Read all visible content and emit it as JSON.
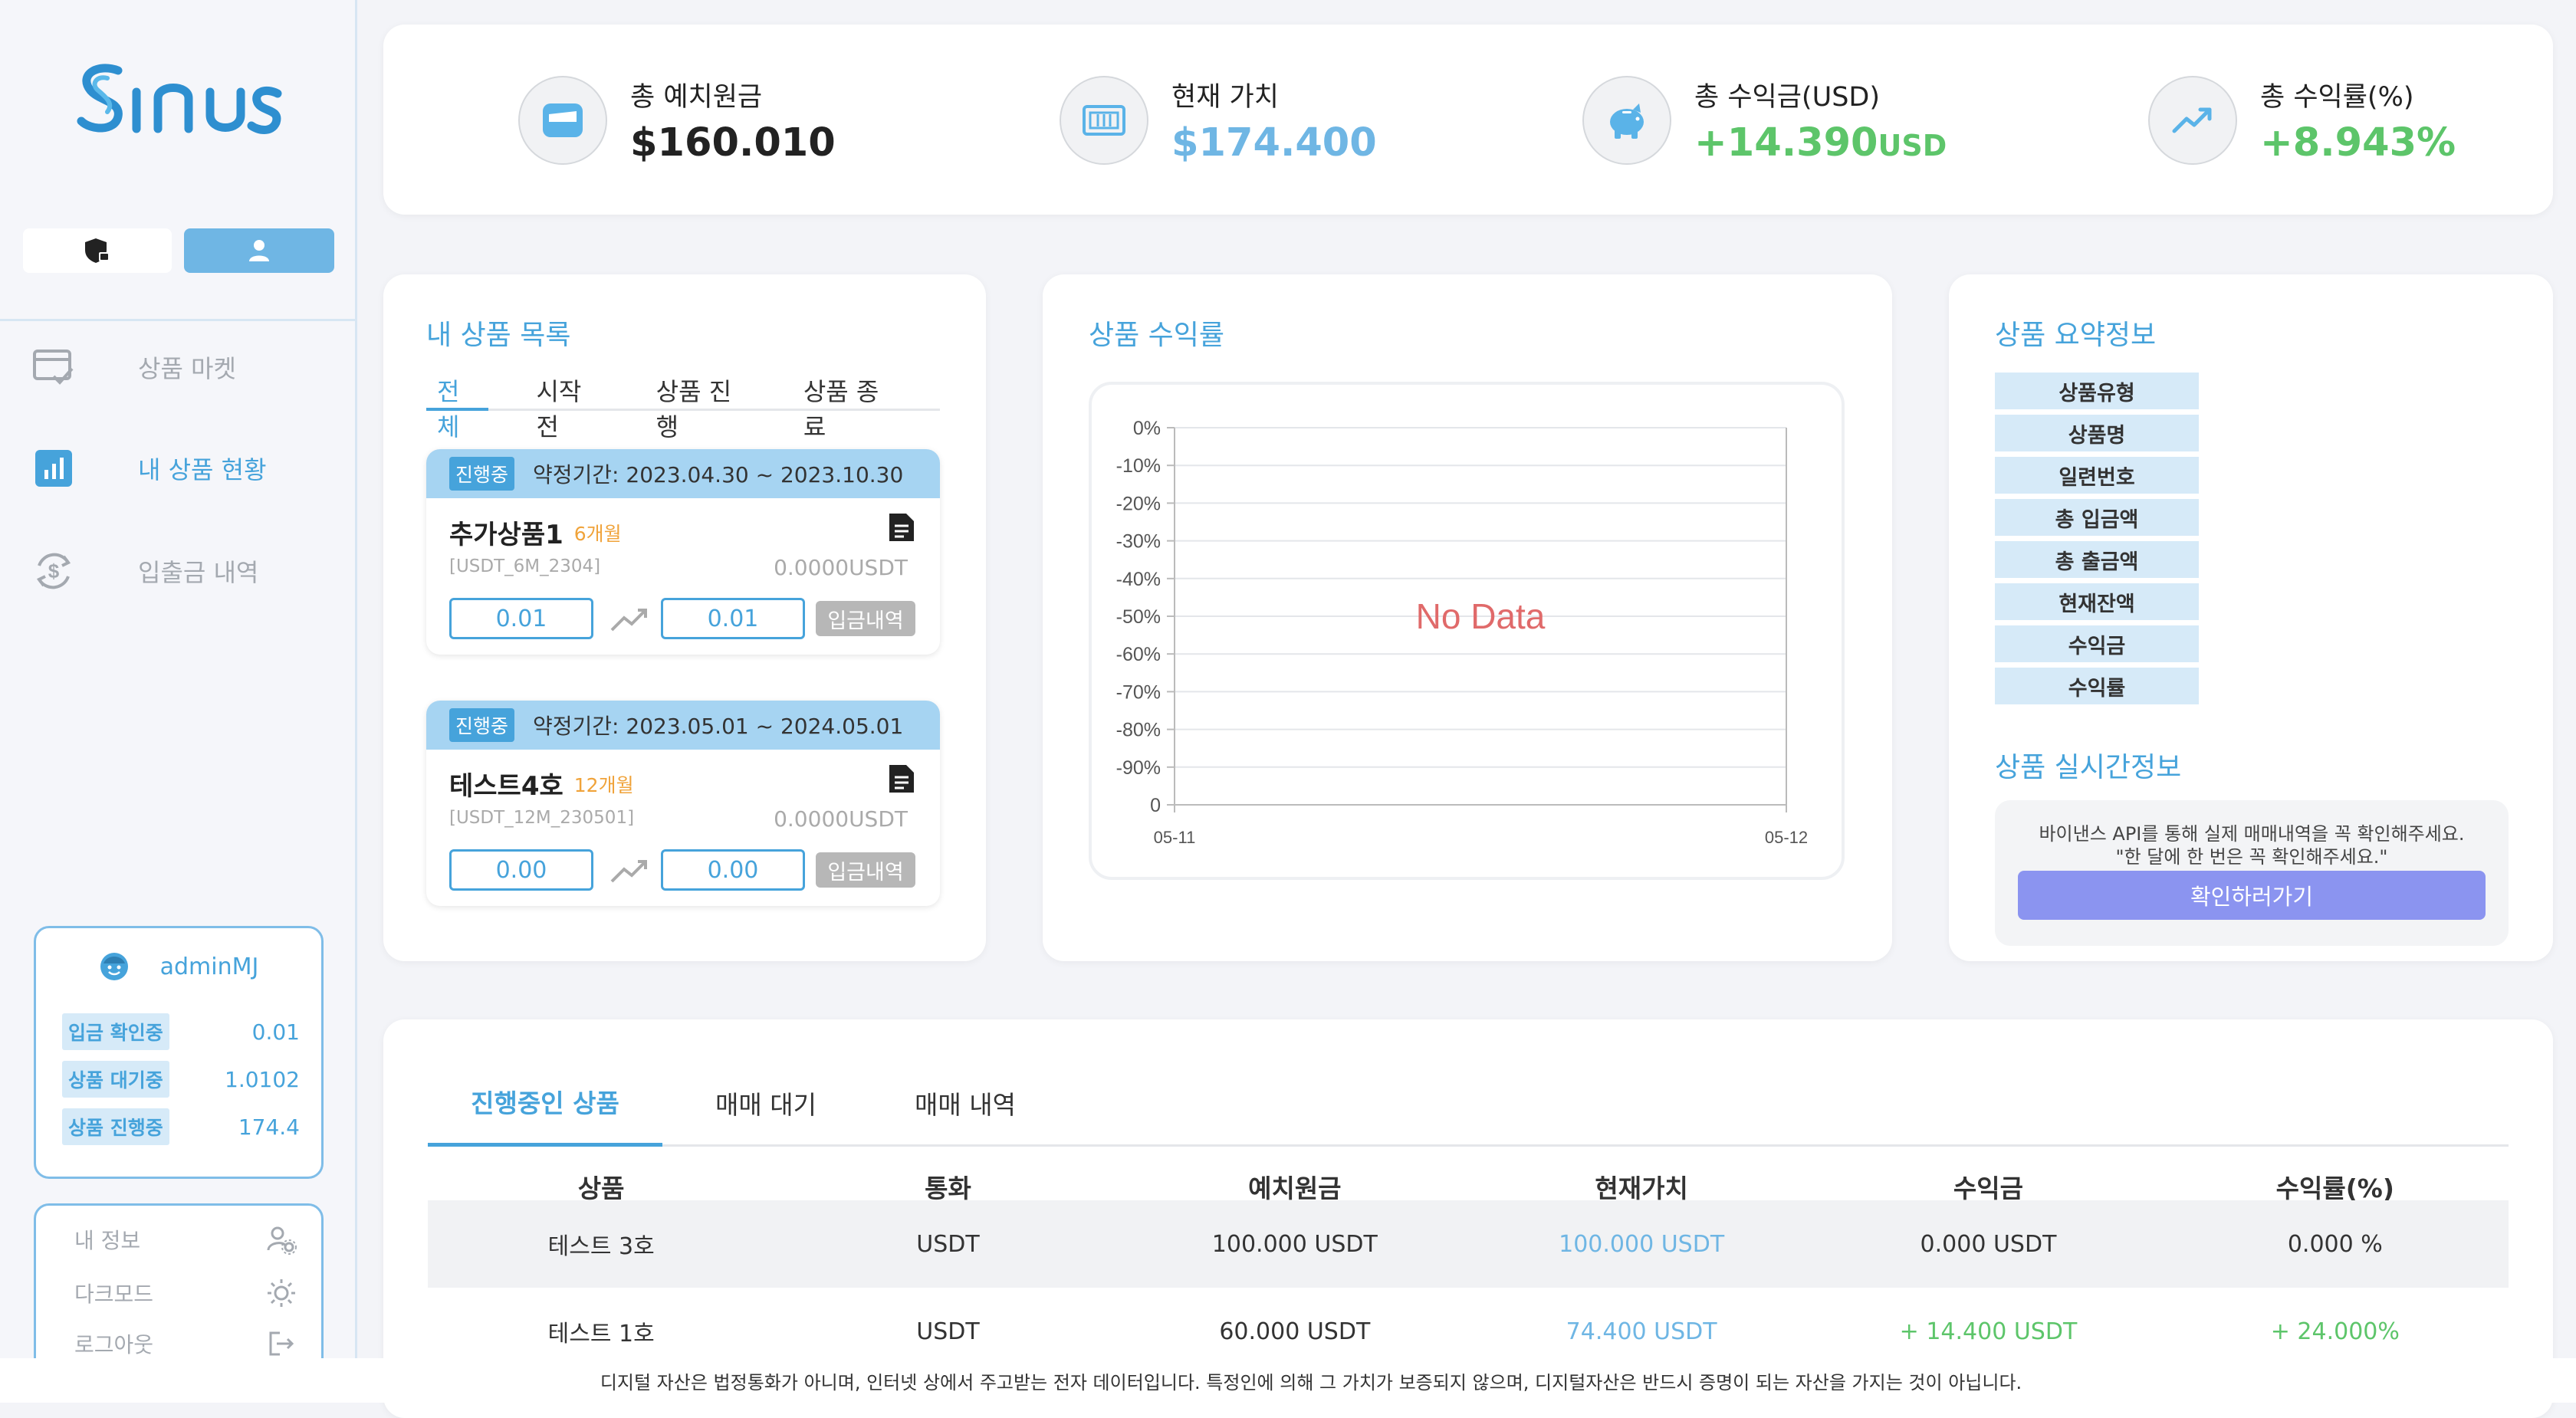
{
  "brand": {
    "name": "Sinus"
  },
  "colors": {
    "accent": "#46a3db",
    "light_accent": "#6fb6e4",
    "positive": "#5dc56a",
    "button_purple": "#8b94f0",
    "badge_orange": "#f0a33a"
  },
  "sidebar": {
    "nav": [
      {
        "label": "상품 마켓",
        "icon": "card-check-icon",
        "active": false
      },
      {
        "label": "내 상품 현황",
        "icon": "bar-chart-icon",
        "active": true
      },
      {
        "label": "입출금 내역",
        "icon": "dollar-cycle-icon",
        "active": false
      }
    ],
    "user": {
      "name": "adminMJ",
      "rows": [
        {
          "label": "입금 확인중",
          "value": "0.01"
        },
        {
          "label": "상품 대기중",
          "value": "1.0102"
        },
        {
          "label": "상품 진행중",
          "value": "174.4"
        }
      ]
    },
    "menu": [
      {
        "label": "내 정보",
        "icon": "user-gear-icon"
      },
      {
        "label": "다크모드",
        "icon": "sun-icon"
      },
      {
        "label": "로그아웃",
        "icon": "logout-icon"
      }
    ]
  },
  "stats": [
    {
      "label": "총 예치원금",
      "value": "$160.010",
      "unit": "",
      "icon": "wallet-icon"
    },
    {
      "label": "현재 가치",
      "value": "$174.400",
      "unit": "",
      "icon": "cash-icon"
    },
    {
      "label": "총 수익금(USD)",
      "value": "+14.390",
      "unit": "USD",
      "icon": "piggy-bank-icon"
    },
    {
      "label": "총 수익률(%)",
      "value": "+8.943%",
      "unit": "",
      "icon": "trend-up-icon"
    }
  ],
  "my_products": {
    "title": "내 상품 목록",
    "tabs": [
      "전체",
      "시작전",
      "상품 진행",
      "상품 종료"
    ],
    "active_tab": 0,
    "items": [
      {
        "status": "진행중",
        "period": "약정기간: 2023.04.30 ~ 2023.10.30",
        "name": "추가상품1",
        "months": "6개월",
        "code": "[USDT_6M_2304]",
        "balance": "0.0000USDT",
        "from": "0.01",
        "to": "0.01",
        "history_label": "입금내역"
      },
      {
        "status": "진행중",
        "period": "약정기간: 2023.05.01 ~ 2024.05.01",
        "name": "테스트4호",
        "months": "12개월",
        "code": "[USDT_12M_230501]",
        "balance": "0.0000USDT",
        "from": "0.00",
        "to": "0.00",
        "history_label": "입금내역"
      }
    ]
  },
  "return_chart": {
    "title": "상품 수익률",
    "no_data": "No Data"
  },
  "chart_data": {
    "type": "line",
    "x": [
      "05-11",
      "05-12"
    ],
    "series": [],
    "y_ticks": [
      "0%",
      "-10%",
      "-20%",
      "-30%",
      "-40%",
      "-50%",
      "-60%",
      "-70%",
      "-80%",
      "-90%",
      "0"
    ],
    "grid": true
  },
  "summary": {
    "title": "상품 요약정보",
    "fields": [
      "상품유형",
      "상품명",
      "일련번호",
      "총 입금액",
      "총 출금액",
      "현재잔액",
      "수익금",
      "수익률"
    ],
    "realtime_title": "상품 실시간정보",
    "realtime_line1": "바이낸스 API를 통해 실제 매매내역을 꼭 확인해주세요.",
    "realtime_line2": "\"한 달에 한 번은 꼭 확인해주세요.\"",
    "realtime_button": "확인하러가기"
  },
  "table": {
    "tabs": [
      "진행중인 상품",
      "매매 대기",
      "매매 내역"
    ],
    "active_tab": 0,
    "columns": [
      "상품",
      "통화",
      "예치원금",
      "현재가치",
      "수익금",
      "수익률(%)"
    ],
    "rows": [
      [
        "테스트 3호",
        "USDT",
        "100.000 USDT",
        "100.000 USDT",
        "0.000 USDT",
        "0.000 %"
      ],
      [
        "테스트 1호",
        "USDT",
        "60.000 USDT",
        "74.400 USDT",
        "+ 14.400 USDT",
        "+ 24.000%"
      ]
    ]
  },
  "footer": "디지털 자산은 법정통화가 아니며, 인터넷 상에서 주고받는 전자 데이터입니다. 특정인에 의해 그 가치가 보증되지 않으며, 디지털자산은 반드시 증명이 되는 자산을 가지는 것이 아닙니다."
}
